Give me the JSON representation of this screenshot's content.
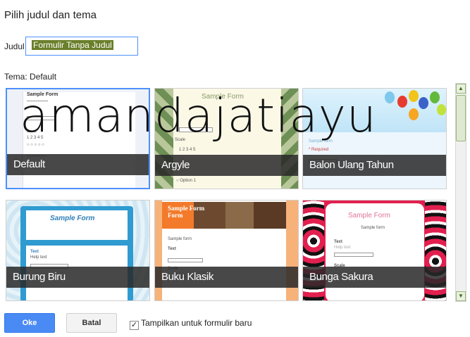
{
  "dialog": {
    "title": "Pilih judul dan tema",
    "title_label": "Judul",
    "title_value": "Formulir Tanpa Judul",
    "theme_label": "Tema: Default"
  },
  "themes": [
    {
      "name": "Default",
      "selected": true
    },
    {
      "name": "Argyle",
      "selected": false
    },
    {
      "name": "Balon Ulang Tahun",
      "selected": false
    },
    {
      "name": "Burung Biru",
      "selected": false
    },
    {
      "name": "Buku Klasik",
      "selected": false
    },
    {
      "name": "Bunga Sakura",
      "selected": false
    }
  ],
  "previews": {
    "default_title": "Sample Form",
    "argyle_title": "Sample Form",
    "burung_title": "Sample Form",
    "buku_title": "Sample Form",
    "sakura_title": "Sample Form"
  },
  "watermark": "amandajatiayu",
  "buttons": {
    "ok": "Oke",
    "cancel": "Batal"
  },
  "checkbox": {
    "label": "Tampilkan untuk formulir baru",
    "checked": true,
    "mark": "✓"
  },
  "colors": {
    "accent": "#4d90fe",
    "ok_button": "#4a8af4"
  }
}
